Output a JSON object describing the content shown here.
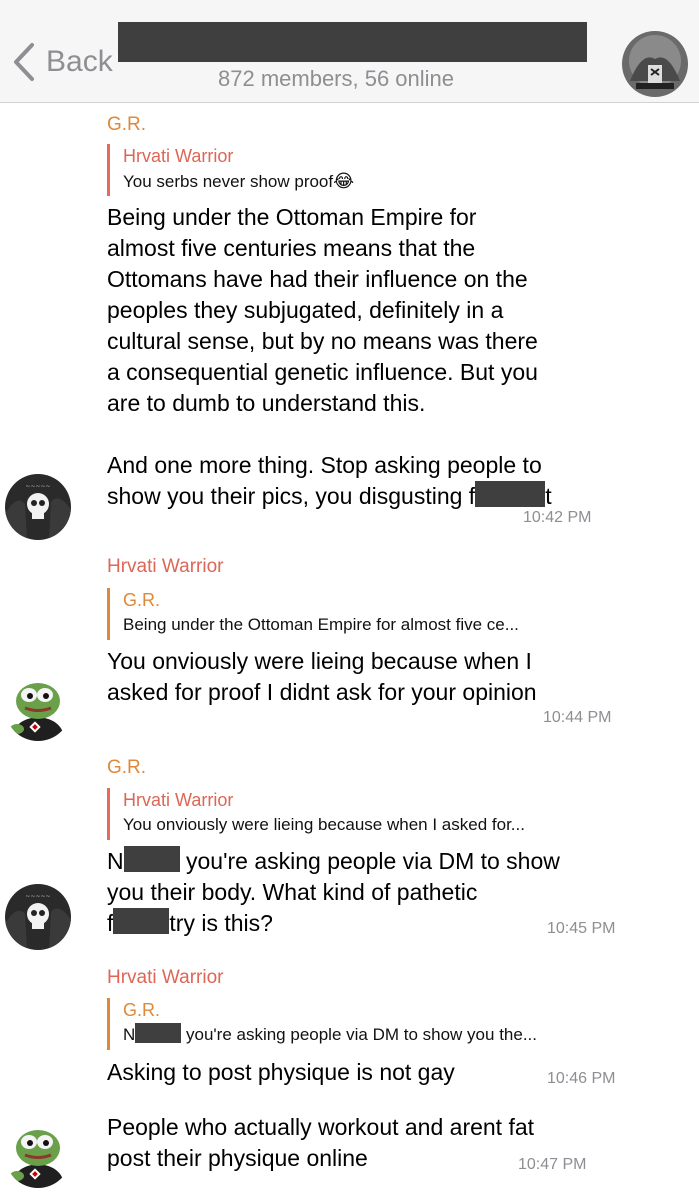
{
  "header": {
    "back_label": "Back",
    "subtitle": "872 members, 56 online"
  },
  "messages": [
    {
      "sender": "G.R.",
      "reply_to": {
        "name": "Hrvati Warrior",
        "text": "You serbs never show proof",
        "emoji": "😂"
      },
      "lines": [
        "Being under the Ottoman Empire for",
        "almost five centuries means that the",
        "Ottomans have had their influence on the",
        "peoples they subjugated, definitely in a",
        "cultural sense, but by no means was there",
        "a consequential genetic influence. But you",
        "are to dumb to understand this.",
        "",
        "And one more thing. Stop asking people to"
      ],
      "last_line_a": "show you their pics, you disgusting f",
      "last_line_b": "t",
      "time": "10:42 PM"
    },
    {
      "sender": "Hrvati Warrior",
      "reply_to": {
        "name": "G.R.",
        "text": "Being under the Ottoman Empire for almost five ce..."
      },
      "lines": [
        "You onviously were lieing because when I",
        "asked for proof I didnt ask for your opinion"
      ],
      "time": "10:44 PM"
    },
    {
      "sender": "G.R.",
      "reply_to": {
        "name": "Hrvati Warrior",
        "text": "You onviously were lieing because when I asked for..."
      },
      "line1_a": "N",
      "line1_b": " you're asking people via DM to show",
      "line2": "you their body. What kind of pathetic",
      "line3_a": "f",
      "line3_b": "try is this?",
      "time": "10:45 PM"
    },
    {
      "sender": "Hrvati Warrior",
      "reply_to": {
        "name": "G.R.",
        "text_a": "N",
        "text_b": " you're asking people via DM to show you the..."
      },
      "lines": [
        "Asking to post physique is not gay"
      ],
      "time": "10:46 PM"
    },
    {
      "lines": [
        "People who actually workout and arent fat",
        "post their physique online"
      ],
      "time": "10:47 PM"
    }
  ],
  "colors": {
    "gr_name": "#e0883a",
    "hw_name": "#dd6656",
    "reply_bar": "#e76a5b",
    "timestamp": "#8e8e93",
    "header_bg": "#f6f6f6",
    "redaction": "#3f3f3f"
  }
}
